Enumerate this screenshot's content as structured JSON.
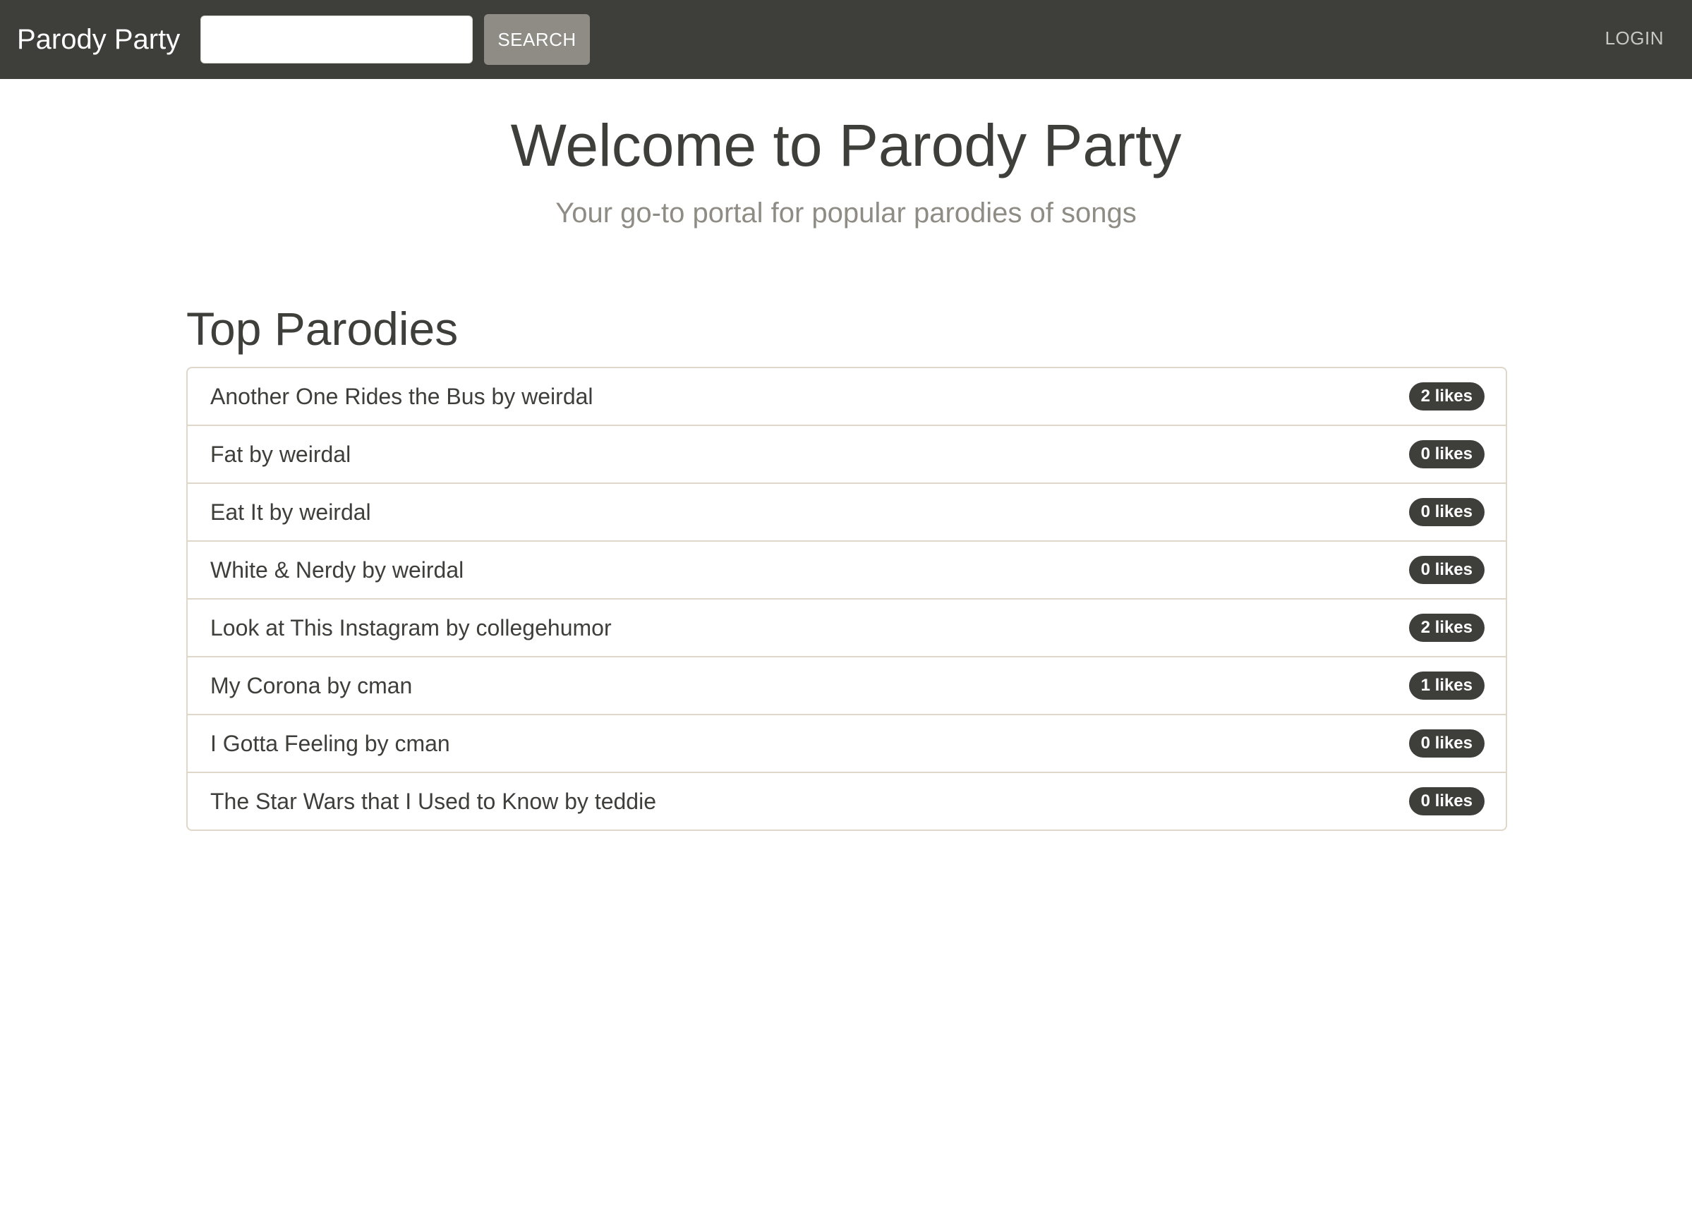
{
  "navbar": {
    "brand": "Parody Party",
    "search_placeholder": "",
    "search_value": "",
    "search_button": "SEARCH",
    "login": "LOGIN"
  },
  "hero": {
    "title": "Welcome to Parody Party",
    "subtitle": "Your go-to portal for popular parodies of songs"
  },
  "top_parodies": {
    "heading": "Top Parodies",
    "items": [
      {
        "title": "Another One Rides the Bus by weirdal",
        "likes": "2 likes"
      },
      {
        "title": "Fat by weirdal",
        "likes": "0 likes"
      },
      {
        "title": "Eat It by weirdal",
        "likes": "0 likes"
      },
      {
        "title": "White & Nerdy by weirdal",
        "likes": "0 likes"
      },
      {
        "title": "Look at This Instagram by collegehumor",
        "likes": "2 likes"
      },
      {
        "title": "My Corona by cman",
        "likes": "1 likes"
      },
      {
        "title": "I Gotta Feeling by cman",
        "likes": "0 likes"
      },
      {
        "title": "The Star Wars that I Used to Know by teddie",
        "likes": "0 likes"
      }
    ]
  },
  "colors": {
    "navbar_bg": "#3e3f3a",
    "search_button_bg": "#8e8c84",
    "badge_bg": "#3e3f3a",
    "border": "#dfd7ca",
    "subtitle": "#8e8c84"
  }
}
